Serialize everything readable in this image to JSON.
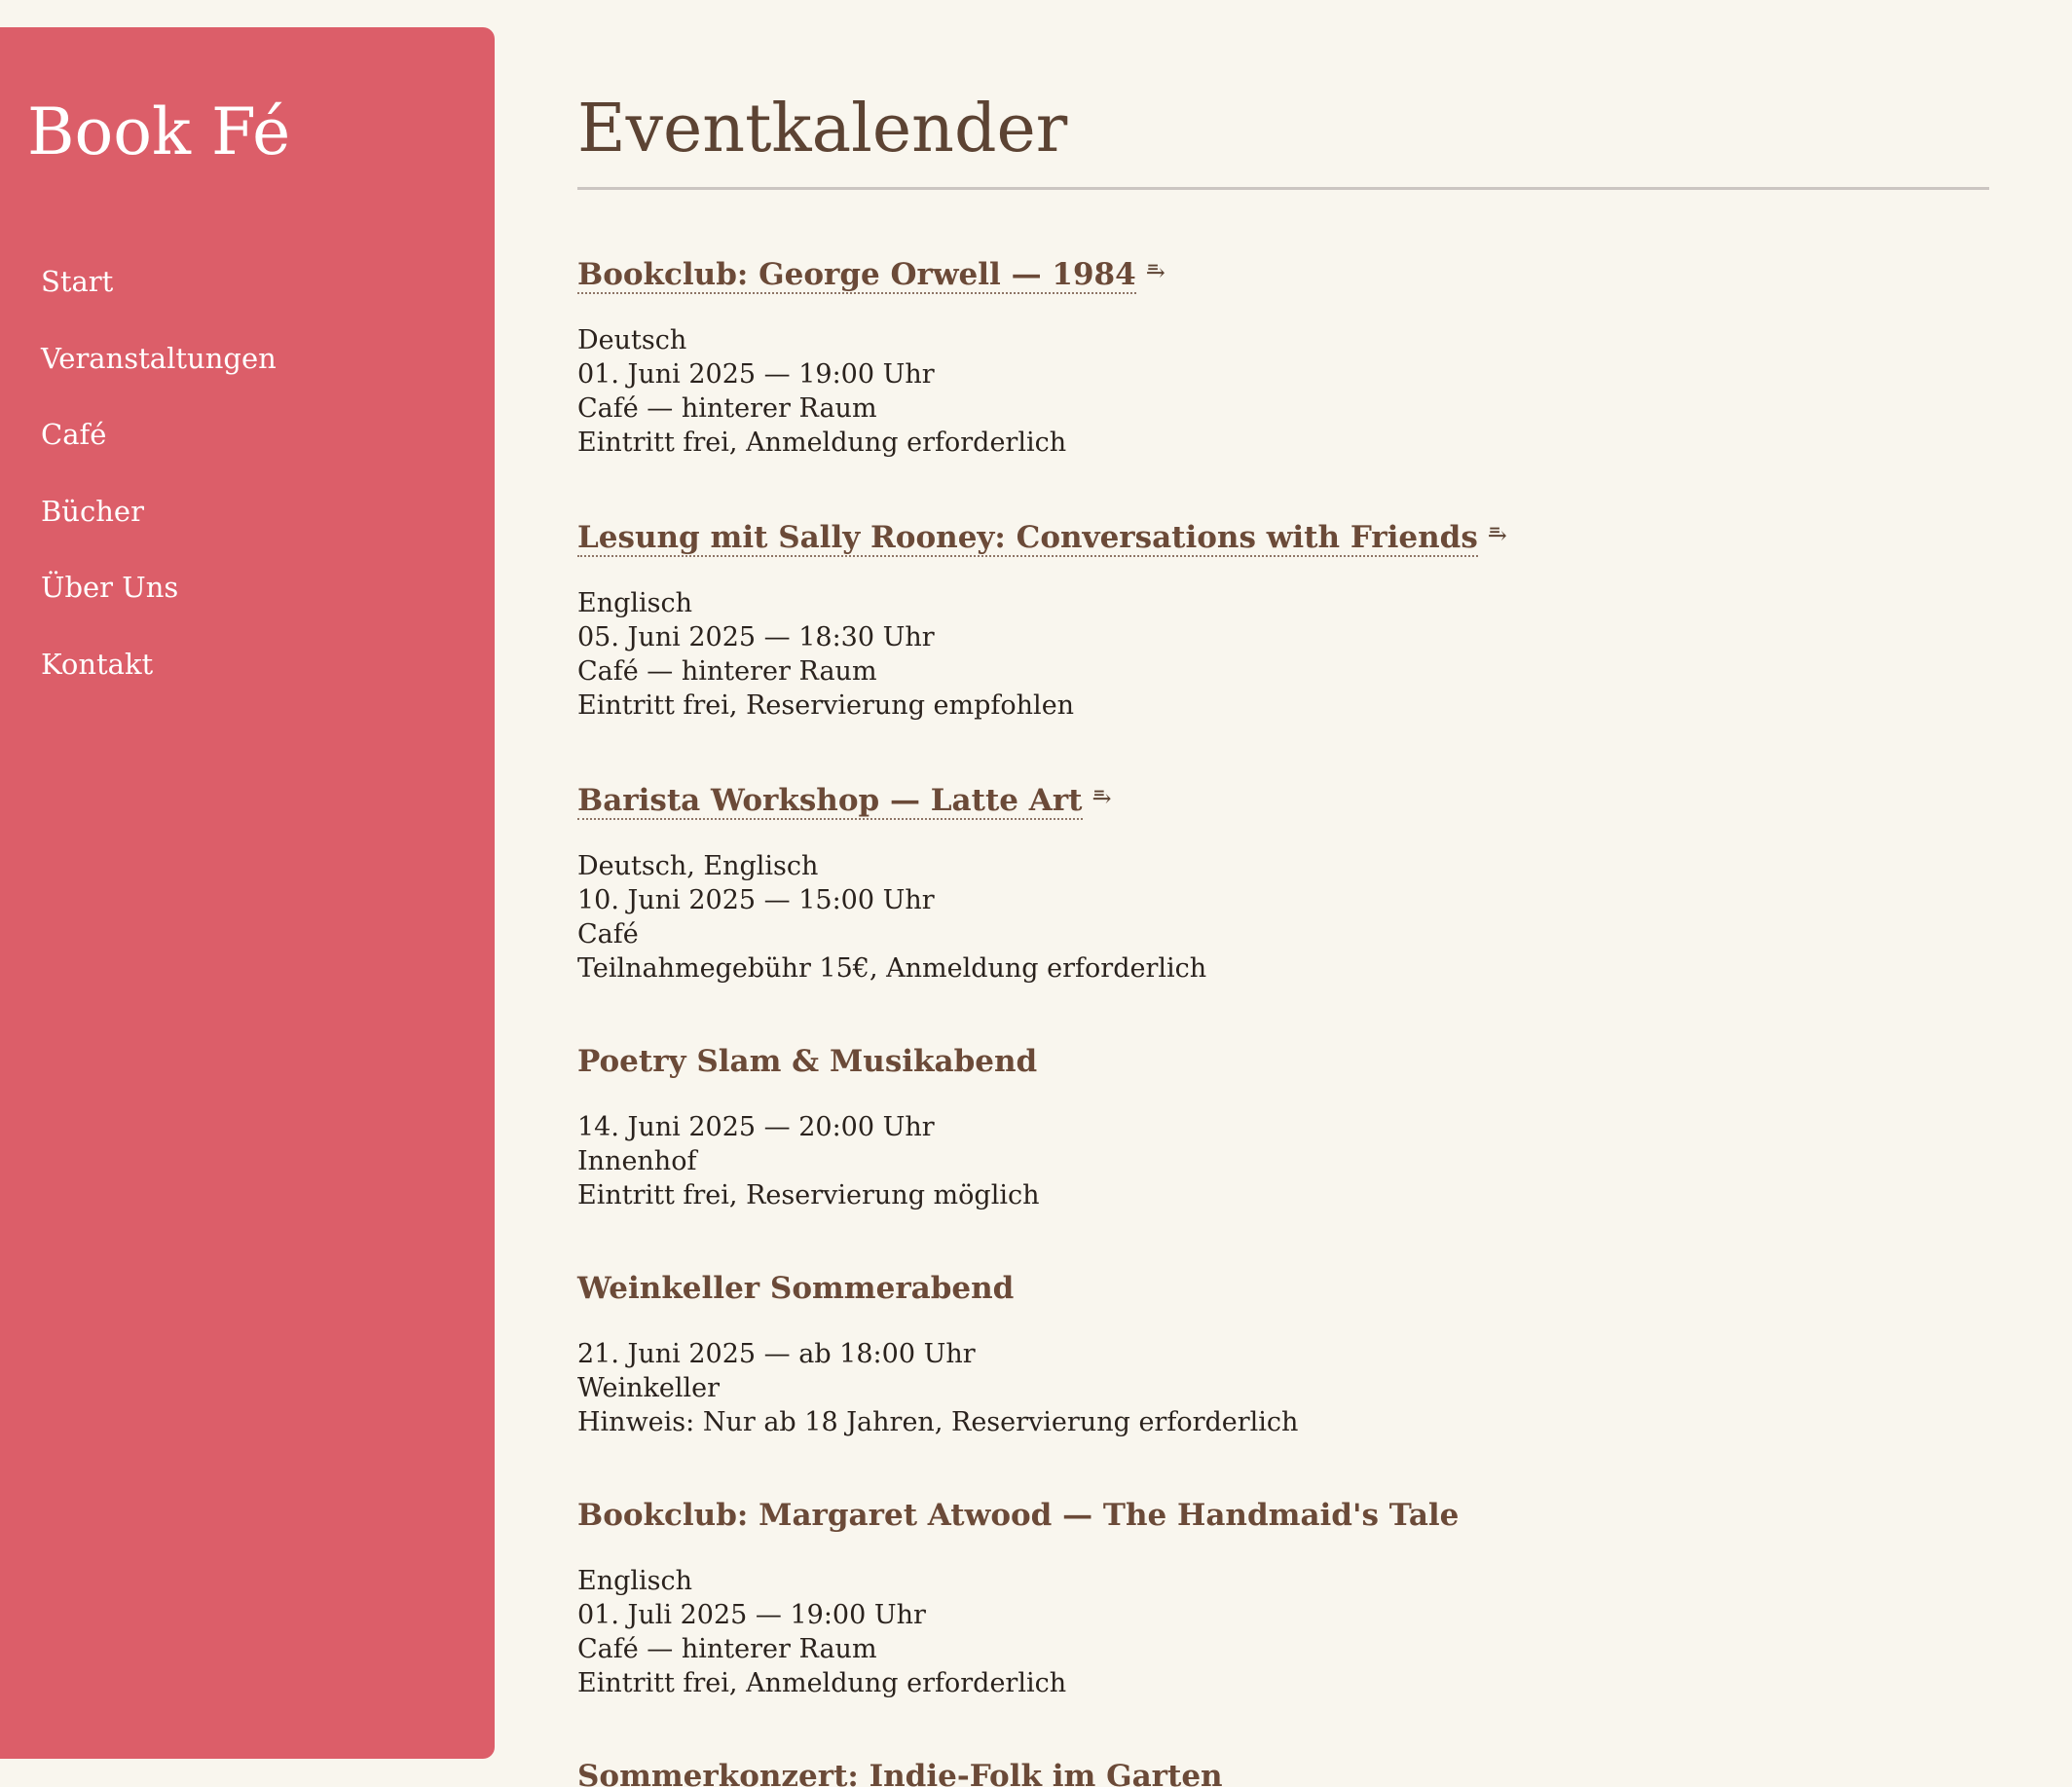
{
  "sidebar": {
    "brand": "Book Fé",
    "nav": [
      {
        "label": "Start"
      },
      {
        "label": "Veranstaltungen"
      },
      {
        "label": "Café"
      },
      {
        "label": "Bücher"
      },
      {
        "label": "Über Uns"
      },
      {
        "label": "Kontakt"
      }
    ]
  },
  "main": {
    "title": "Eventkalender",
    "link_icon": "⥱",
    "events": [
      {
        "title": "Bookclub: George Orwell — 1984",
        "language": "Deutsch",
        "datetime": "01. Juni 2025 — 19:00 Uhr",
        "location": "Café — hinterer Raum",
        "note": "Eintritt frei, Anmeldung erforderlich"
      },
      {
        "title": "Lesung mit Sally Rooney: Conversations with Friends",
        "language": "Englisch",
        "datetime": "05. Juni 2025 — 18:30 Uhr",
        "location": "Café — hinterer Raum",
        "note": "Eintritt frei, Reservierung empfohlen"
      },
      {
        "title": "Barista Workshop — Latte Art",
        "language": "Deutsch, Englisch",
        "datetime": "10. Juni 2025 — 15:00 Uhr",
        "location": "Café",
        "note": "Teilnahmegebühr 15€, Anmeldung erforderlich"
      },
      {
        "title": "Poetry Slam & Musikabend",
        "datetime": "14. Juni 2025 — 20:00 Uhr",
        "location": "Innenhof",
        "note": "Eintritt frei, Reservierung möglich"
      },
      {
        "title": "Weinkeller Sommerabend",
        "datetime": "21. Juni 2025 — ab 18:00 Uhr",
        "location": "Weinkeller",
        "note": "Hinweis: Nur ab 18 Jahren, Reservierung erforderlich"
      },
      {
        "title": "Bookclub: Margaret Atwood — The Handmaid's Tale",
        "language": "Englisch",
        "datetime": "01. Juli 2025 — 19:00 Uhr",
        "location": "Café — hinterer Raum",
        "note": "Eintritt frei, Anmeldung erforderlich"
      },
      {
        "title": "Sommerkonzert: Indie-Folk im Garten"
      }
    ]
  }
}
